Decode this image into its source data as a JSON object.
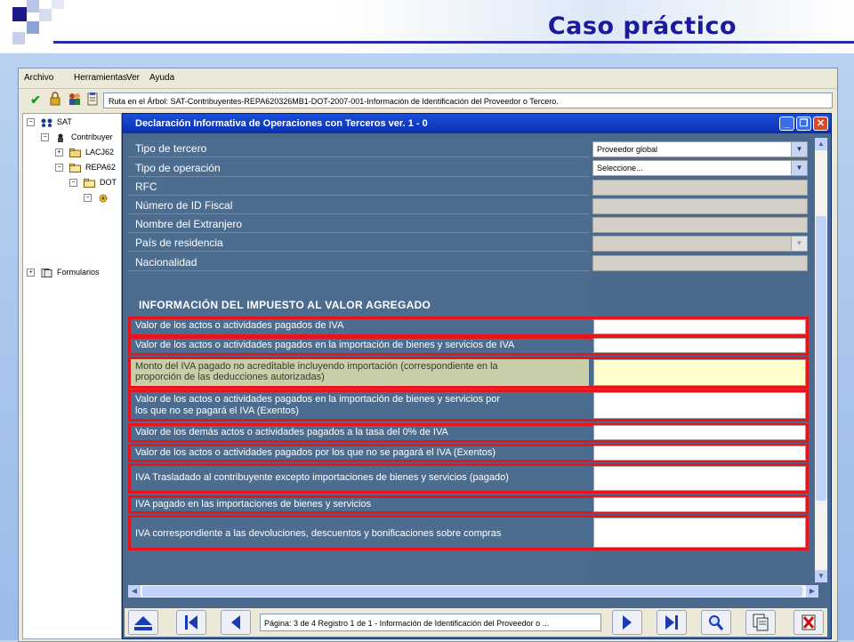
{
  "slide": {
    "title": "Caso práctico",
    "accent_color": "#1a1aa0"
  },
  "menu": [
    "Archivo",
    "Herramientas",
    "Ver",
    "Ayuda"
  ],
  "toolbar": {
    "icons": [
      "check-icon",
      "lock-icon",
      "users-icon",
      "clipboard-icon"
    ],
    "path": "Ruta en el Árbol: SAT-Contribuyentes-REPA620326MB1-DOT-2007-001-Información de Identificación del Proveedor o Tercero."
  },
  "tree": {
    "root": "SAT",
    "contribuyentes": "Contribuyer",
    "node1": "LACJ62",
    "node2": "REPA62",
    "node3": "DOT",
    "formularios": "Formularios"
  },
  "dialog": {
    "title": "Declaración Informativa de Operaciones con Terceros ver. 1 - 0",
    "fields": [
      {
        "label": "Tipo de tercero",
        "value": "Proveedor global"
      },
      {
        "label": "Tipo de operación",
        "value": "Seleccione..."
      },
      {
        "label": "RFC",
        "value": ""
      },
      {
        "label": "Número de ID Fiscal",
        "value": ""
      },
      {
        "label": "Nombre del Extranjero",
        "value": ""
      },
      {
        "label": "País de residencia",
        "value": ""
      },
      {
        "label": "Nacionalidad",
        "value": ""
      }
    ],
    "section_title": "INFORMACIÓN DEL IMPUESTO AL VALOR AGREGADO",
    "iva_fields": [
      {
        "label1": "Valor de los actos o actividades pagados de IVA",
        "label2": ""
      },
      {
        "label1": "Valor de los actos o actividades pagados en la importación de bienes y servicios de IVA",
        "label2": ""
      },
      {
        "label1": "Monto del IVA pagado no acreditable incluyendo importación (correspondiente en la",
        "label2": "proporción de las deducciones autorizadas)"
      },
      {
        "label1": "Valor de los actos o actividades pagados en la importación de bienes y servicios por",
        "label2": "los que no se pagará el IVA (Exentos)"
      },
      {
        "label1": "Valor de los demás actos o actividades pagados a la tasa del 0% de IVA",
        "label2": ""
      },
      {
        "label1": "Valor de los actos o actividades pagados por los que no se pagará el IVA (Exentos)",
        "label2": ""
      },
      {
        "label1": "IVA Trasladado al contribuyente excepto importaciones de bienes y servicios (pagado)",
        "label2": ""
      },
      {
        "label1": "IVA pagado en las importaciones de bienes y servicios",
        "label2": ""
      },
      {
        "label1": "IVA correspondiente a las devoluciones, descuentos y bonificaciones sobre compras",
        "label2": ""
      }
    ]
  },
  "navbar": {
    "status": "Página: 3   de   4 Registro  1   de   1  - Información de Identificación del Proveedor o ..."
  }
}
